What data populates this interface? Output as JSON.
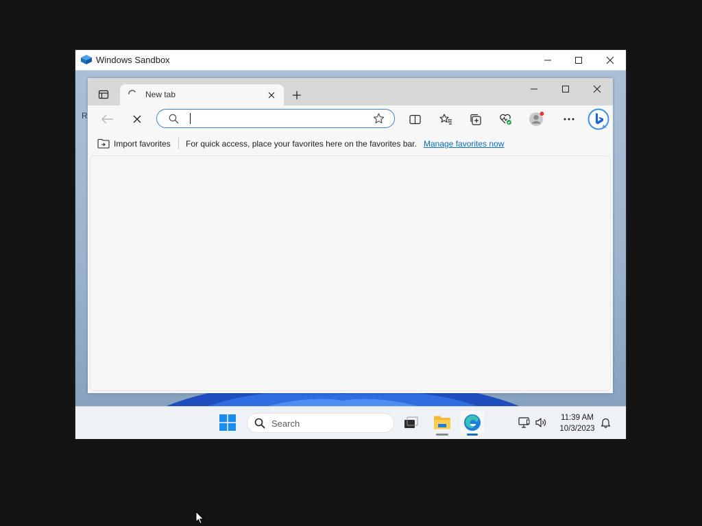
{
  "sandbox": {
    "title": "Windows Sandbox",
    "desktop_label": "R"
  },
  "browser": {
    "tab": {
      "title": "New tab"
    },
    "address_bar": {
      "value": "",
      "placeholder": ""
    },
    "favorites_bar": {
      "import_label": "Import favorites",
      "message": "For quick access, place your favorites here on the favorites bar.",
      "manage_link": "Manage favorites now"
    }
  },
  "taskbar": {
    "search_label": "Search",
    "clock": {
      "time": "11:39 AM",
      "date": "10/3/2023"
    }
  },
  "colors": {
    "accent": "#0f6cbd",
    "address_focus": "#3d7bd9",
    "notification_dot": "#e53935"
  },
  "icons": [
    "sandbox-logo-icon",
    "minimize-icon",
    "maximize-icon",
    "close-icon",
    "tab-actions-icon",
    "loading-spinner-icon",
    "plus-icon",
    "back-arrow-icon",
    "stop-loading-icon",
    "search-icon",
    "star-icon",
    "split-screen-icon",
    "favorites-icon",
    "collections-icon",
    "browser-essentials-icon",
    "profile-icon",
    "more-icon",
    "bing-copilot-icon",
    "import-favorites-icon",
    "windows-start-icon",
    "task-view-icon",
    "file-explorer-icon",
    "edge-icon",
    "network-icon",
    "volume-icon",
    "bell-icon",
    "mouse-pointer-icon"
  ]
}
